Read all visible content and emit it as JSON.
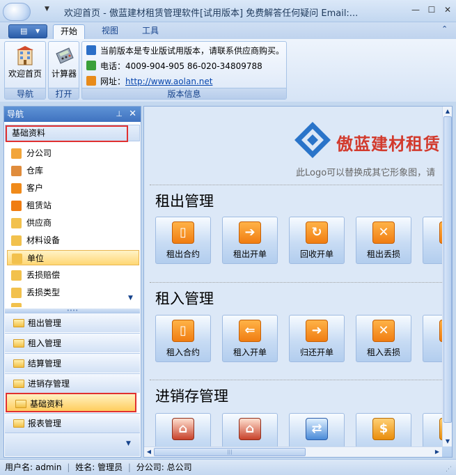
{
  "window": {
    "title": "欢迎首页 - 傲蓝建材租赁管理软件[试用版本] 免费解答任何疑问 Email:...",
    "minimize": "—",
    "maximize": "☐",
    "close": "✕"
  },
  "ribbon": {
    "tabs": [
      "开始",
      "视图",
      "工具"
    ],
    "collapse_glyph": "⌃",
    "groups": {
      "nav": {
        "label": "导航",
        "button": "欢迎首页"
      },
      "open": {
        "label": "打开",
        "button": "计算器"
      },
      "info": {
        "label": "版本信息",
        "notice": "当前版本是专业版试用版本，请联系供应商购买。",
        "phone_label": "电话：",
        "phone": "4009-904-905  86-020-34809788",
        "web_label": "网址：",
        "web": "http://www.aolan.net"
      }
    }
  },
  "nav": {
    "header": "导航",
    "pin": "⊥",
    "close": "✕",
    "group_title": "基础资料",
    "items": [
      "分公司",
      "仓库",
      "客户",
      "租赁站",
      "供应商",
      "材料设备",
      "单位",
      "丢损赔偿",
      "丢损类型",
      "..."
    ],
    "selected": "单位",
    "bars": [
      "租出管理",
      "租入管理",
      "结算管理",
      "进销存管理",
      "基础资料",
      "报表管理"
    ],
    "active_bar": "基础资料"
  },
  "content": {
    "logo_text": "傲蓝建材租赁",
    "logo_hint": "此Logo可以替换成其它形象图，请",
    "sections": [
      {
        "title": "租出管理",
        "tiles": [
          "租出合约",
          "租出开单",
          "回收开单",
          "租出丢损",
          "租"
        ]
      },
      {
        "title": "租入管理",
        "tiles": [
          "租入合约",
          "租入开单",
          "归还开单",
          "租入丢损",
          "租"
        ]
      },
      {
        "title": "进销存管理",
        "tiles": [
          "",
          "",
          "",
          "",
          ""
        ]
      }
    ]
  },
  "status": {
    "user_label": "用户名:",
    "user": "admin",
    "name_label": "姓名:",
    "name": "管理员",
    "branch_label": "分公司:",
    "branch": "总公司"
  },
  "colors": {
    "ribbon_blue": "#15428b",
    "accent_orange": "#f07d12",
    "selection_yellow": "#ffd774",
    "highlight_red": "#e03030"
  }
}
